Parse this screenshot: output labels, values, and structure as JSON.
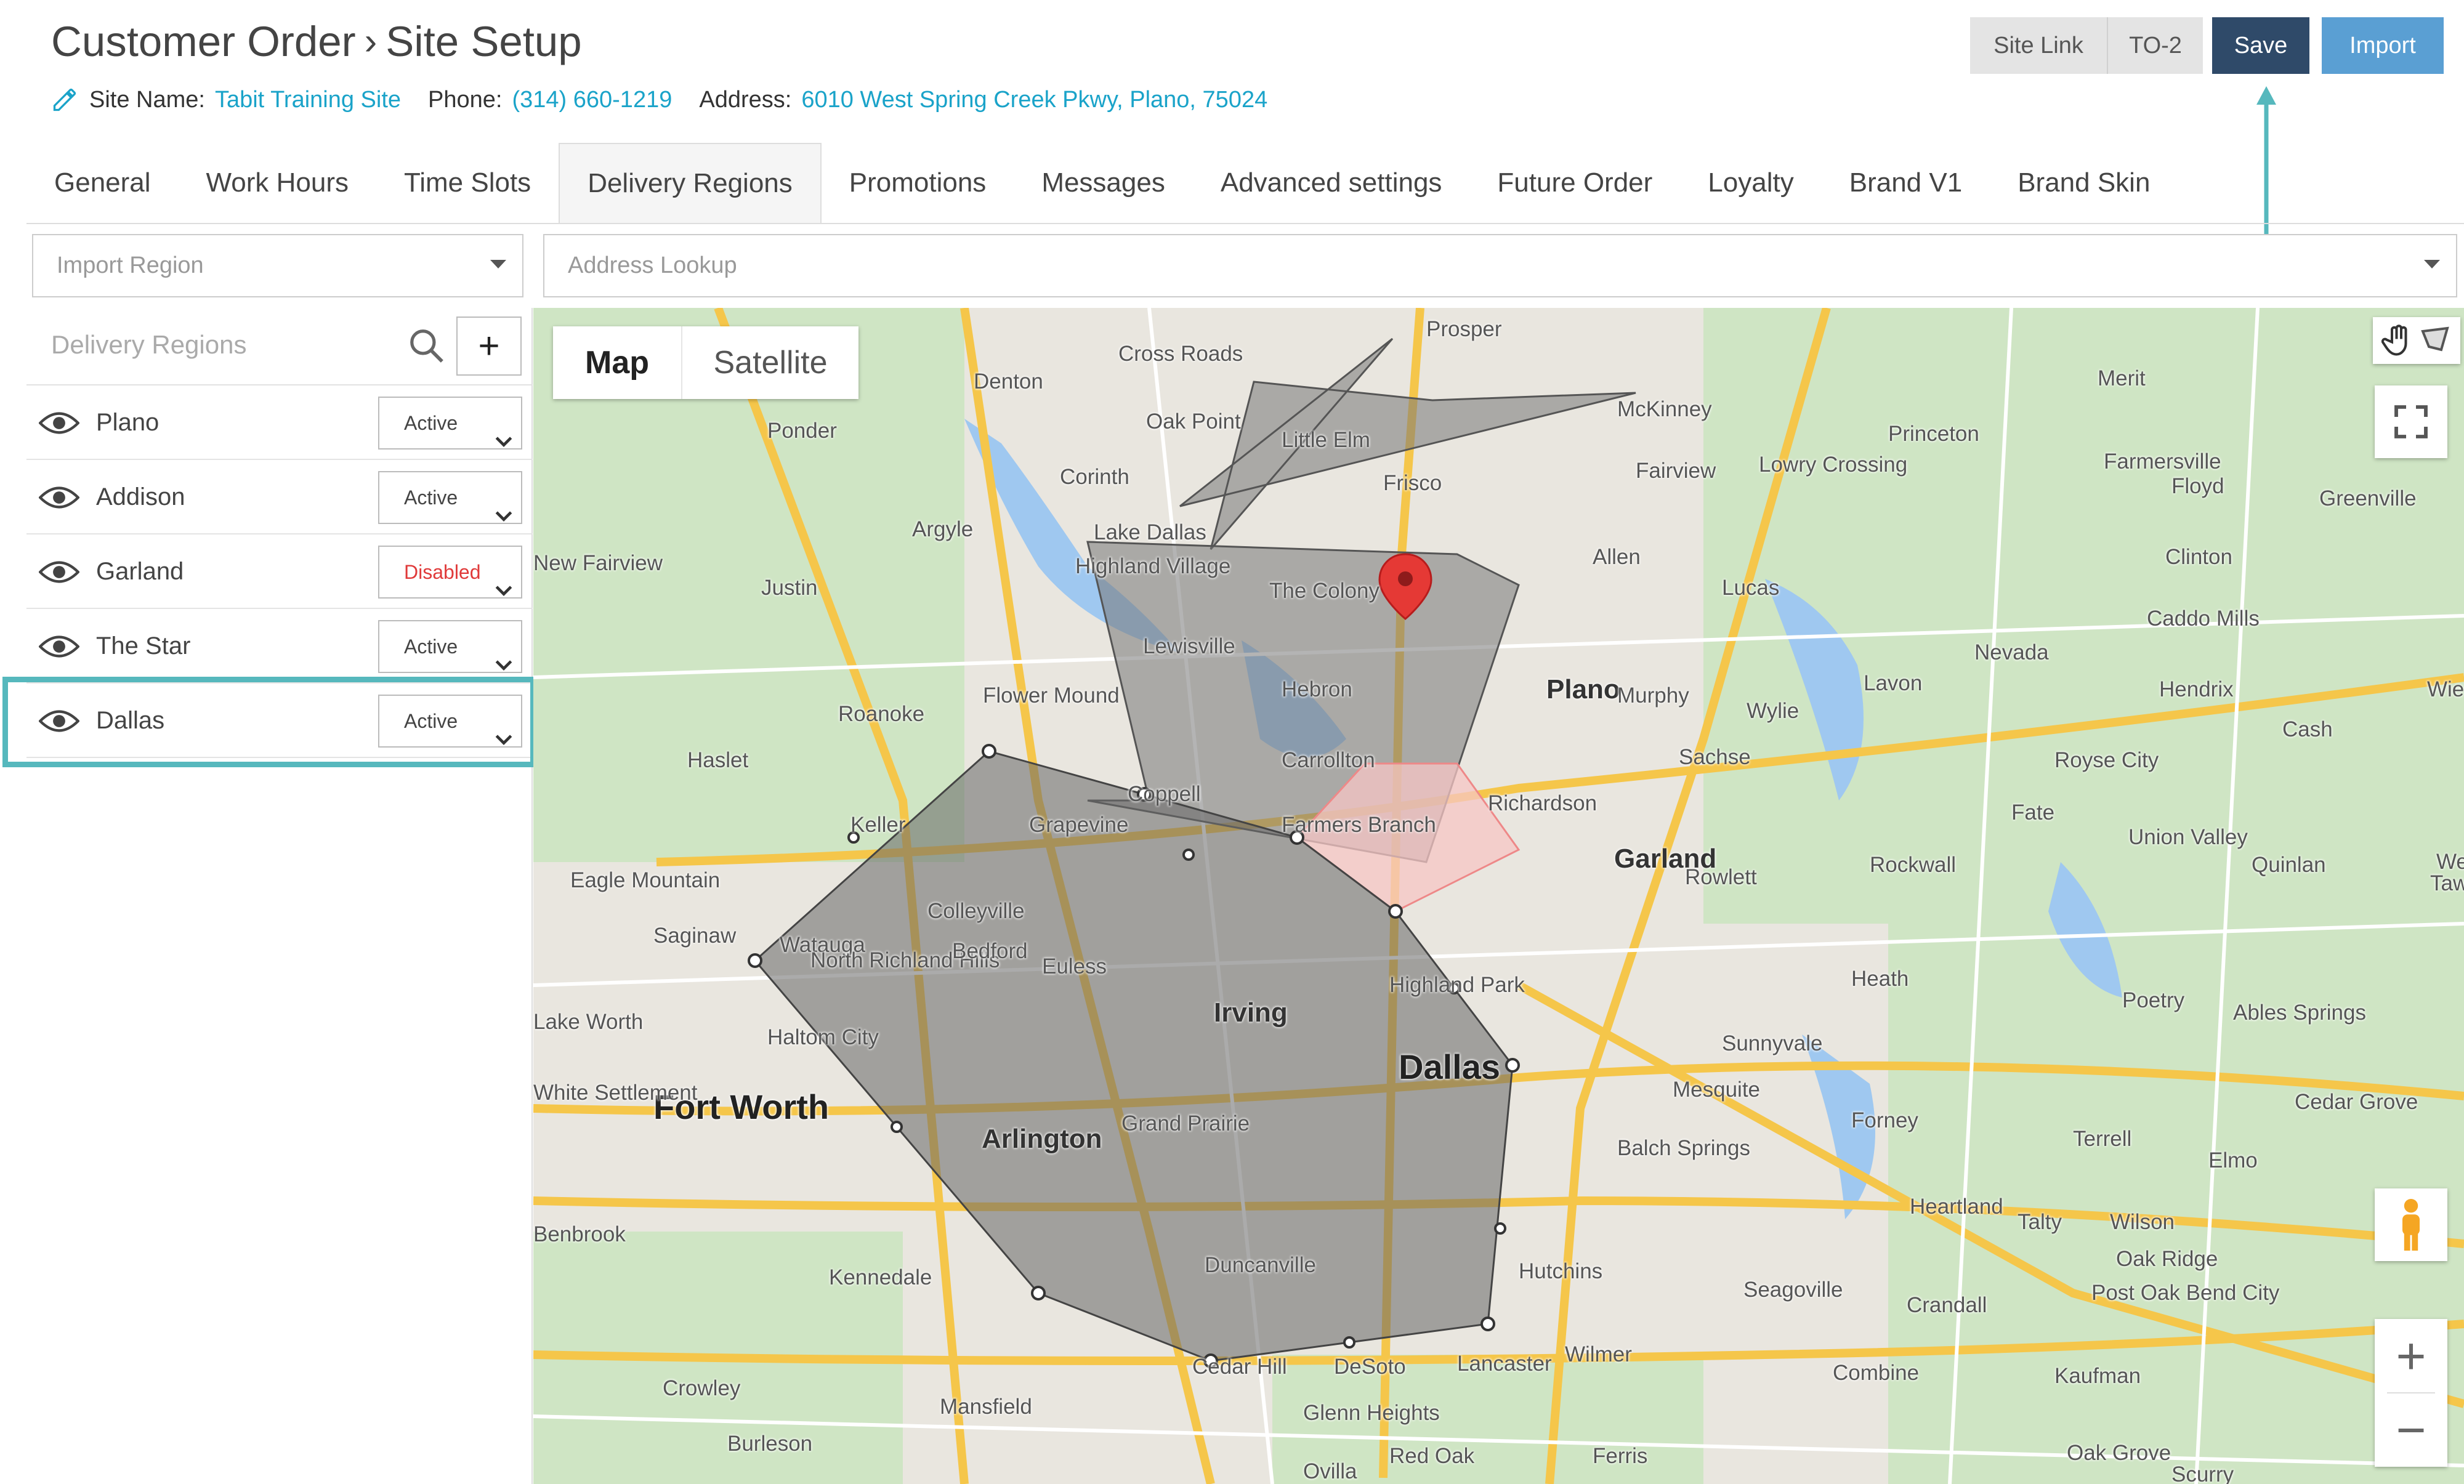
{
  "header": {
    "breadcrumb": [
      "Customer Order",
      "Site Setup"
    ],
    "site_name_label": "Site Name:",
    "site_name": "Tabit Training Site",
    "phone_label": "Phone:",
    "phone": "(314) 660-1219",
    "address_label": "Address:",
    "address": "6010 West Spring Creek Pkwy, Plano, 75024",
    "buttons": {
      "site_link": "Site Link",
      "to2": "TO-2",
      "save": "Save",
      "import": "Import"
    }
  },
  "tabs": [
    "General",
    "Work Hours",
    "Time Slots",
    "Delivery Regions",
    "Promotions",
    "Messages",
    "Advanced settings",
    "Future Order",
    "Loyalty",
    "Brand V1",
    "Brand Skin"
  ],
  "active_tab": "Delivery Regions",
  "toolbar": {
    "import_region_placeholder": "Import Region",
    "address_lookup_placeholder": "Address Lookup"
  },
  "panel": {
    "title": "Delivery Regions",
    "add_label": "+",
    "regions": [
      {
        "name": "Plano",
        "status": "Active"
      },
      {
        "name": "Addison",
        "status": "Active"
      },
      {
        "name": "Garland",
        "status": "Disabled"
      },
      {
        "name": "The Star",
        "status": "Active"
      },
      {
        "name": "Dallas",
        "status": "Active"
      }
    ],
    "selected_region": "Dallas"
  },
  "map": {
    "map_type_options": [
      "Map",
      "Satellite"
    ],
    "selected_map_type": "Map",
    "zoom_in": "+",
    "zoom_out": "−",
    "places": [
      {
        "name": "Dallas",
        "size": "big"
      },
      {
        "name": "Fort Worth",
        "size": "big"
      },
      {
        "name": "Plano",
        "size": "mid"
      },
      {
        "name": "Garland",
        "size": "mid"
      },
      {
        "name": "Irving",
        "size": "mid"
      },
      {
        "name": "Arlington",
        "size": "mid"
      },
      {
        "name": "Prosper"
      },
      {
        "name": "Cross Roads"
      },
      {
        "name": "McKinney"
      },
      {
        "name": "Denton"
      },
      {
        "name": "Oak Point"
      },
      {
        "name": "Little Elm"
      },
      {
        "name": "Merit"
      },
      {
        "name": "Princeton"
      },
      {
        "name": "Farmersville"
      },
      {
        "name": "Ponder"
      },
      {
        "name": "Frisco"
      },
      {
        "name": "Fairview"
      },
      {
        "name": "Lowry Crossing"
      },
      {
        "name": "Floyd"
      },
      {
        "name": "Greenville"
      },
      {
        "name": "Corinth"
      },
      {
        "name": "Argyle"
      },
      {
        "name": "Lake Dallas"
      },
      {
        "name": "Allen"
      },
      {
        "name": "Clinton"
      },
      {
        "name": "Highland Village"
      },
      {
        "name": "Justin"
      },
      {
        "name": "The Colony"
      },
      {
        "name": "Lucas"
      },
      {
        "name": "New Fairview"
      },
      {
        "name": "Caddo Mills"
      },
      {
        "name": "Lewisville"
      },
      {
        "name": "Nevada"
      },
      {
        "name": "Lavon"
      },
      {
        "name": "Hebron"
      },
      {
        "name": "Murphy"
      },
      {
        "name": "Hendrix"
      },
      {
        "name": "Flower Mound"
      },
      {
        "name": "Wylie"
      },
      {
        "name": "Roanoke"
      },
      {
        "name": "Cash"
      },
      {
        "name": "Haslet"
      },
      {
        "name": "Carrollton"
      },
      {
        "name": "Sachse"
      },
      {
        "name": "Royse City"
      },
      {
        "name": "Coppell"
      },
      {
        "name": "Richardson"
      },
      {
        "name": "Keller"
      },
      {
        "name": "Grapevine"
      },
      {
        "name": "Fate"
      },
      {
        "name": "Farmers Branch"
      },
      {
        "name": "Union Valley"
      },
      {
        "name": "Rowlett"
      },
      {
        "name": "Rockwall"
      },
      {
        "name": "Quinlan"
      },
      {
        "name": "Eagle Mountain"
      },
      {
        "name": "Colleyville"
      },
      {
        "name": "Saginaw"
      },
      {
        "name": "Watauga"
      },
      {
        "name": "North Richland Hills"
      },
      {
        "name": "Bedford"
      },
      {
        "name": "Euless"
      },
      {
        "name": "Highland Park"
      },
      {
        "name": "Heath"
      },
      {
        "name": "Poetry"
      },
      {
        "name": "Ables Springs"
      },
      {
        "name": "Lake Worth"
      },
      {
        "name": "Haltom City"
      },
      {
        "name": "Sunnyvale"
      },
      {
        "name": "Mesquite"
      },
      {
        "name": "Forney"
      },
      {
        "name": "Cedar Grove"
      },
      {
        "name": "White Settlement"
      },
      {
        "name": "Grand Prairie"
      },
      {
        "name": "Terrell"
      },
      {
        "name": "Elmo"
      },
      {
        "name": "Balch Springs"
      },
      {
        "name": "Heartland"
      },
      {
        "name": "Talty"
      },
      {
        "name": "Wilson"
      },
      {
        "name": "Benbrook"
      },
      {
        "name": "Oak Ridge"
      },
      {
        "name": "Post Oak Bend City"
      },
      {
        "name": "Duncanville"
      },
      {
        "name": "Hutchins"
      },
      {
        "name": "Kennedale"
      },
      {
        "name": "Seagoville"
      },
      {
        "name": "Crandall"
      },
      {
        "name": "Cedar Hill"
      },
      {
        "name": "DeSoto"
      },
      {
        "name": "Lancaster"
      },
      {
        "name": "Wilmer"
      },
      {
        "name": "Combine"
      },
      {
        "name": "Kaufman"
      },
      {
        "name": "Crowley"
      },
      {
        "name": "Mansfield"
      },
      {
        "name": "Glenn Heights"
      },
      {
        "name": "Burleson"
      },
      {
        "name": "Red Oak"
      },
      {
        "name": "Ferris"
      },
      {
        "name": "Oak Grove"
      },
      {
        "name": "Ovilla"
      },
      {
        "name": "Scurry"
      },
      {
        "name": "Wiel"
      },
      {
        "name": "Tawa"
      },
      {
        "name": "We"
      }
    ]
  },
  "colors": {
    "accent": "#1aa3c9",
    "save": "#2f4a69",
    "import": "#5a9fd3",
    "highlight": "#56b8bd",
    "disabled": "#e03a3a",
    "region_fill": "#777777",
    "garland_fill": "#f6c6c4"
  },
  "icons": [
    "pencil-icon",
    "search-icon",
    "eye-icon",
    "chevron-down-icon",
    "hand-icon",
    "polygon-draw-icon",
    "fullscreen-icon",
    "pegman-icon",
    "map-pin-icon",
    "arrow-up-icon"
  ]
}
